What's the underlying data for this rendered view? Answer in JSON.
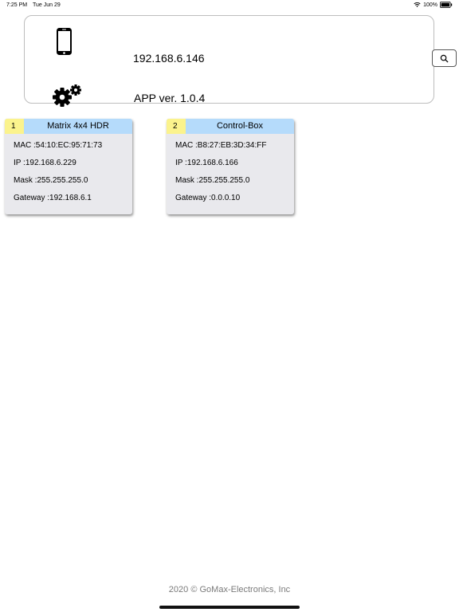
{
  "status_bar": {
    "time": "7:25 PM",
    "date": "Tue Jun 29",
    "battery": "100%"
  },
  "header": {
    "ip_address": "192.168.6.146",
    "app_version": "APP ver. 1.0.4"
  },
  "devices": [
    {
      "index": "1",
      "title": "Matrix 4x4 HDR",
      "mac": "MAC :54:10:EC:95:71:73",
      "ip": "IP :192.168.6.229",
      "mask": "Mask :255.255.255.0",
      "gateway": "Gateway :192.168.6.1"
    },
    {
      "index": "2",
      "title": "Control-Box",
      "mac": "MAC :B8:27:EB:3D:34:FF",
      "ip": "IP :192.168.6.166",
      "mask": "Mask :255.255.255.0",
      "gateway": "Gateway :0.0.0.10"
    }
  ],
  "footer": {
    "copyright": "2020  © GoMax-Electronics, Inc"
  },
  "colors": {
    "card_header_blue": "#b5dbfb",
    "card_index_yellow": "#fbf38d",
    "card_body_gray": "#e9e9ed"
  },
  "icons": {
    "device": "phone-icon",
    "settings": "gear-icon",
    "search": "search-icon",
    "wifi": "wifi-icon",
    "battery": "battery-icon"
  }
}
